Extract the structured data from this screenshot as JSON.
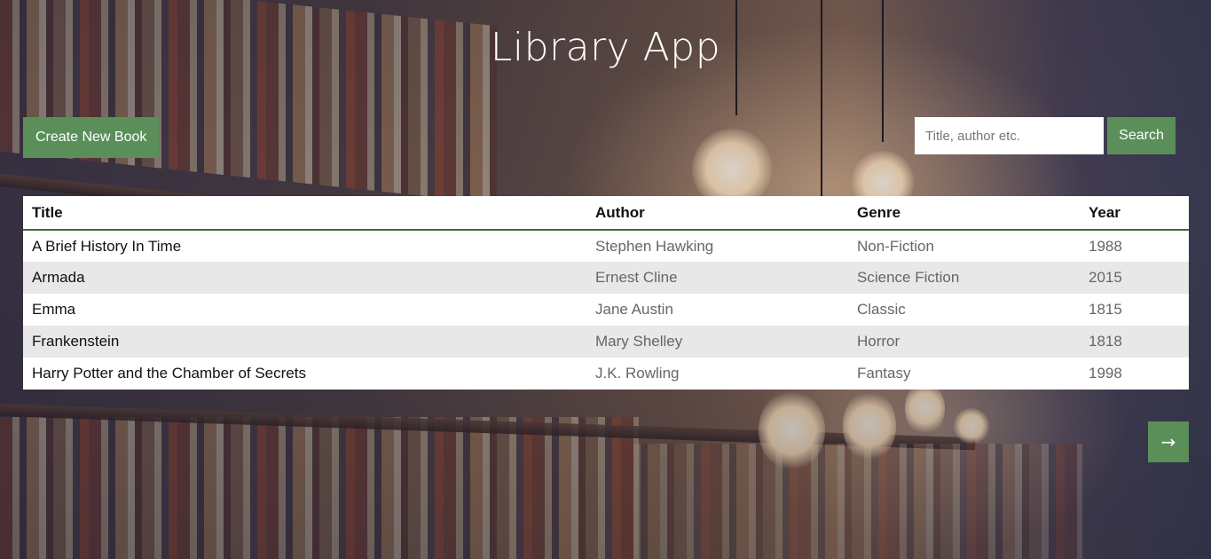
{
  "header": {
    "title": "Library App"
  },
  "toolbar": {
    "create_label": "Create New Book",
    "search_placeholder": "Title, author etc.",
    "search_value": "",
    "search_label": "Search"
  },
  "table": {
    "columns": [
      "Title",
      "Author",
      "Genre",
      "Year"
    ],
    "rows": [
      {
        "title": "A Brief History In Time",
        "author": "Stephen Hawking",
        "genre": "Non-Fiction",
        "year": "1988"
      },
      {
        "title": "Armada",
        "author": "Ernest Cline",
        "genre": "Science Fiction",
        "year": "2015"
      },
      {
        "title": "Emma",
        "author": "Jane Austin",
        "genre": "Classic",
        "year": "1815"
      },
      {
        "title": "Frankenstein",
        "author": "Mary Shelley",
        "genre": "Horror",
        "year": "1818"
      },
      {
        "title": "Harry Potter and the Chamber of Secrets",
        "author": "J.K. Rowling",
        "genre": "Fantasy",
        "year": "1998"
      }
    ]
  },
  "pagination": {
    "next_icon": "arrow-right-icon",
    "next_glyph": "→"
  },
  "colors": {
    "accent_green": "#5a8f5a",
    "header_rule": "#3c6e3c",
    "row_alt": "#e8e8e8",
    "title_text": "#ffffff"
  }
}
